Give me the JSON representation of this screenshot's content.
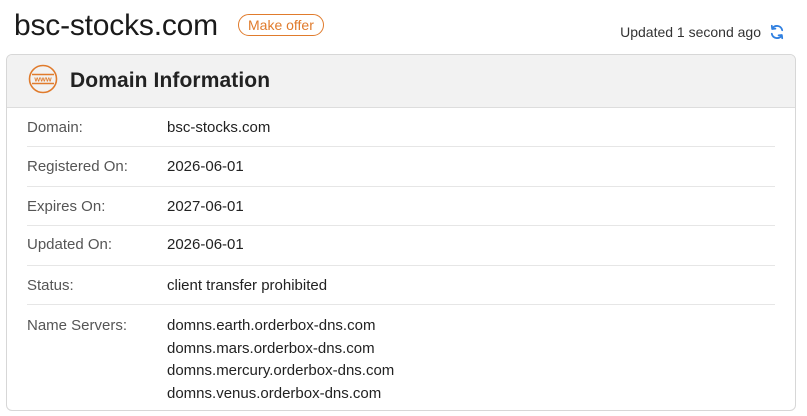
{
  "header": {
    "domain_title": "bsc-stocks.com",
    "offer_label": "Make offer",
    "updated_text": "Updated 1 second ago",
    "accent_color": "#e07b2c",
    "refresh_color": "#2f7fe0"
  },
  "panel": {
    "icon": "www-icon",
    "title": "Domain Information",
    "rows": [
      {
        "label": "Domain:",
        "value": "bsc-stocks.com"
      },
      {
        "label": "Registered On:",
        "value": "2026-06-01"
      },
      {
        "label": "Expires On:",
        "value": "2027-06-01"
      },
      {
        "label": "Updated On:",
        "value": "2026-06-01"
      },
      {
        "label": "Status:",
        "value": "client transfer prohibited"
      },
      {
        "label": "Name Servers:",
        "values": [
          "domns.earth.orderbox-dns.com",
          "domns.mars.orderbox-dns.com",
          "domns.mercury.orderbox-dns.com",
          "domns.venus.orderbox-dns.com"
        ]
      }
    ]
  }
}
